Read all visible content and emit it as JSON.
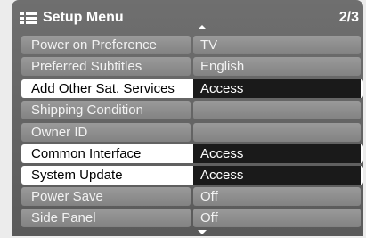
{
  "header": {
    "title": "Setup Menu",
    "page": "2/3",
    "menu_icon": "list-icon",
    "scroll_up_icon": "arrow-up-icon",
    "scroll_down_icon": "arrow-down-icon"
  },
  "rows": [
    {
      "label": "Power on Preference",
      "value": "TV",
      "state": "normal"
    },
    {
      "label": "Preferred Subtitles",
      "value": "English",
      "state": "normal"
    },
    {
      "label": "Add Other Sat. Services",
      "value": "Access",
      "state": "highlighted"
    },
    {
      "label": "Shipping Condition",
      "value": "",
      "state": "normal"
    },
    {
      "label": "Owner ID",
      "value": "",
      "state": "normal"
    },
    {
      "label": "Common Interface",
      "value": "Access",
      "state": "highlighted"
    },
    {
      "label": "System Update",
      "value": "Access",
      "state": "highlighted"
    },
    {
      "label": "Power Save",
      "value": "Off",
      "state": "normal"
    },
    {
      "label": "Side Panel",
      "value": "Off",
      "state": "normal"
    }
  ],
  "colors": {
    "panel": "#656565",
    "row_normal": "#8e8e8e",
    "row_highlight": "#ffffff",
    "value_highlight": "#1a1a1a",
    "text": "#ffffff"
  }
}
